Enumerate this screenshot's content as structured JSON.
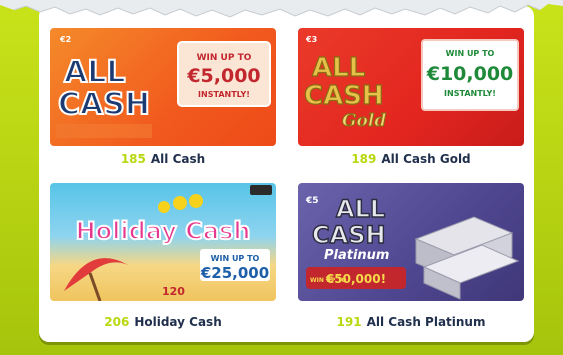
{
  "games": [
    {
      "number": "185",
      "name": "All Cash",
      "ticket_title_top": "ALL",
      "ticket_title_bottom": "CASH",
      "prize_line1": "WIN UP TO",
      "prize_amount": "€5,000",
      "prize_line2": "INSTANTLY!",
      "price": "€2",
      "accent": "#f36d21"
    },
    {
      "number": "189",
      "name": "All Cash Gold",
      "ticket_title_top": "ALL",
      "ticket_title_bottom": "CASH",
      "ticket_title_sub": "Gold",
      "prize_line1": "WIN UP TO",
      "prize_amount": "€10,000",
      "prize_line2": "INSTANTLY!",
      "price": "€3",
      "accent": "#e2251f"
    },
    {
      "number": "206",
      "name": "Holiday Cash",
      "ticket_title": "Holiday Cash",
      "prize_line1": "WIN UP TO",
      "prize_amount": "€25,000",
      "ticket_code": "120",
      "accent": "#e5398f"
    },
    {
      "number": "191",
      "name": "All Cash Platinum",
      "ticket_title_top": "ALL",
      "ticket_title_bottom": "CASH",
      "ticket_title_sub": "Platinum",
      "prize_line1": "WIN UP TO",
      "prize_amount": "€50,000!",
      "price": "€5",
      "accent": "#5a4f9a"
    }
  ],
  "colors": {
    "lime": "#b9d80f",
    "navy": "#1f2f4c"
  }
}
